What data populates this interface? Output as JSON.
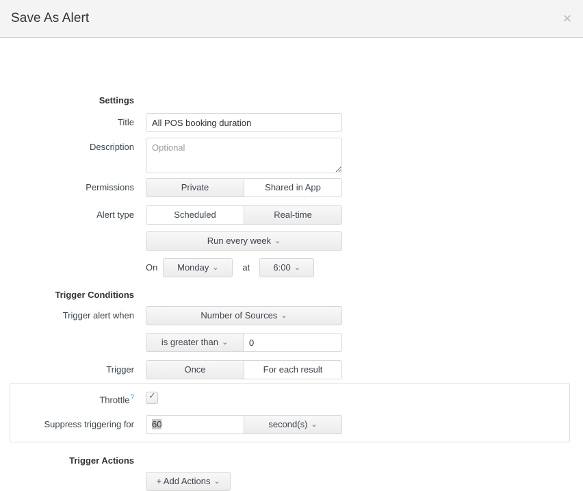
{
  "header": {
    "title": "Save As Alert",
    "close_icon": "close-icon",
    "close_glyph": "✕"
  },
  "sections": {
    "settings": "Settings",
    "trigger_conditions": "Trigger Conditions",
    "trigger_actions": "Trigger Actions"
  },
  "labels": {
    "title": "Title",
    "description": "Description",
    "permissions": "Permissions",
    "alert_type": "Alert type",
    "trigger_alert_when": "Trigger alert when",
    "trigger": "Trigger",
    "throttle": "Throttle",
    "suppress_triggering_for": "Suppress triggering for",
    "on": "On",
    "at": "at"
  },
  "fields": {
    "title_value": "All POS booking duration",
    "description_placeholder": "Optional",
    "description_value": "",
    "condition_value": "0",
    "suppress_value": "60"
  },
  "toggles": {
    "permissions": {
      "options": [
        "Private",
        "Shared in App"
      ],
      "selected": "Shared in App"
    },
    "alert_type": {
      "options": [
        "Scheduled",
        "Real-time"
      ],
      "selected": "Scheduled"
    },
    "trigger": {
      "options": [
        "Once",
        "For each result"
      ],
      "selected": "For each result"
    }
  },
  "dropdowns": {
    "schedule": "Run every week",
    "day": "Monday",
    "time": "6:00",
    "trigger_field": "Number of Sources",
    "comparator": "is greater than",
    "time_unit": "second(s)",
    "add_actions": "+ Add Actions",
    "caret_glyph": "⌄"
  },
  "throttle": {
    "help_glyph": "?",
    "checked": true,
    "check_glyph": "✓"
  },
  "colors": {
    "header_bg": "#f4f4f4",
    "border": "#d6d6d6",
    "text": "#3c444d",
    "link": "#3c92d1",
    "selection": "#c8c8c8"
  }
}
